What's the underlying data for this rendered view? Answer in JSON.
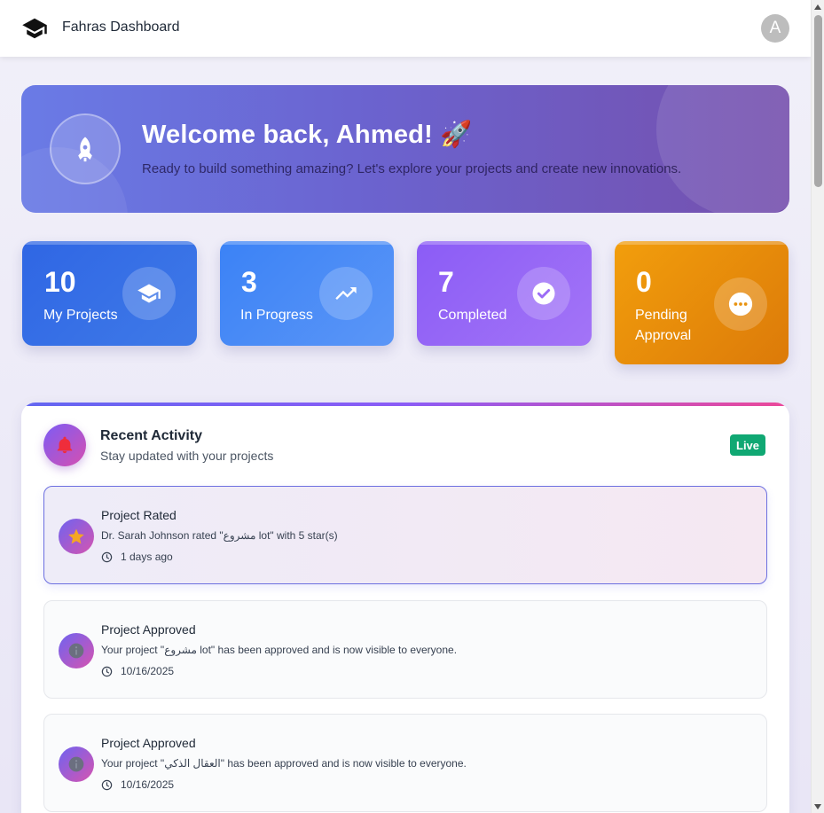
{
  "header": {
    "app_title": "Fahras Dashboard",
    "avatar_letter": "A"
  },
  "banner": {
    "title": "Welcome back, Ahmed! 🚀",
    "subtitle": "Ready to build something amazing? Let's explore your projects and create new innovations."
  },
  "stats": [
    {
      "value": "10",
      "label": "My Projects",
      "icon": "graduation-cap-icon",
      "color": "#2f66e4"
    },
    {
      "value": "3",
      "label": "In Progress",
      "icon": "trending-up-icon",
      "color": "#3b82f6"
    },
    {
      "value": "7",
      "label": "Completed",
      "icon": "check-circle-icon",
      "color": "#8b5cf6"
    },
    {
      "value": "0",
      "label": "Pending Approval",
      "icon": "more-horizontal-icon",
      "color": "#f29e0c"
    }
  ],
  "activity": {
    "title": "Recent Activity",
    "subtitle": "Stay updated with your projects",
    "live_label": "Live",
    "items": [
      {
        "title": "Project Rated",
        "text": "Dr. Sarah Johnson rated \"مشروع lot\" with 5 star(s)",
        "time": "1 days ago",
        "icon": "star-icon"
      },
      {
        "title": "Project Approved",
        "text": "Your project \"مشروع lot\" has been approved and is now visible to everyone.",
        "time": "10/16/2025",
        "icon": "info-icon"
      },
      {
        "title": "Project Approved",
        "text": "Your project \"العقال الذكي\" has been approved and is now visible to everyone.",
        "time": "10/16/2025",
        "icon": "info-icon"
      }
    ]
  }
}
